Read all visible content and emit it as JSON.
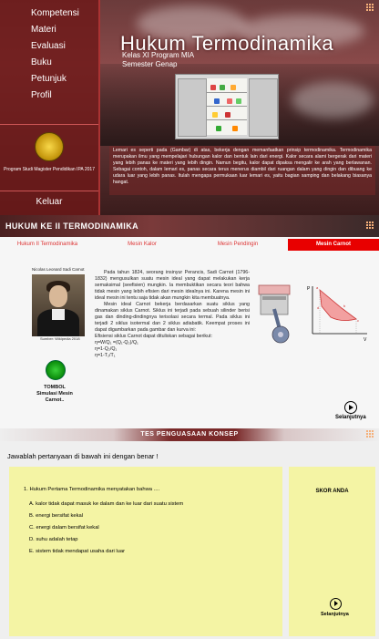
{
  "home": {
    "menu": [
      {
        "label": "Kompetensi"
      },
      {
        "label": "Materi"
      },
      {
        "label": "Evaluasi"
      },
      {
        "label": "Buku"
      },
      {
        "label": "Petunjuk"
      },
      {
        "label": "Profil"
      }
    ],
    "org_text": "Program Studi Magister Pendidikan IPA 2017",
    "exit_label": "Keluar",
    "title": "Hukum Termodinamika",
    "subtitle_class": "Kelas XI Program MIA",
    "subtitle_semester": "Semester Genap",
    "description": "Lemari es seperti pada (Gambar) di atas, bekerja dengan memanfaatkan prinsip termodinamika. Termodinamika merupakan ilmu yang mempelajari hubungan kalor dan bentuk lain dari energi. Kalor secara alami bergerak dari materi yang lebih panas ke materi yang lebih dingin. Namun begitu, kalor dapat dipaksa mengalir ke arah yang berlawanan. Sebagai contoh, dalam lemari es, panas secara terus menerus diambil dari ruangan dalam yang dingin dan dibuang ke udara luar yang lebih panas. Itulah mengapa permukaan luar lemari es, yaitu bagian samping dan belakang biasanya hangat."
  },
  "materi": {
    "header": "HUKUM KE II TERMODINAMIKA",
    "tabs": [
      {
        "label": "Hukum II Termodinamika",
        "active": false
      },
      {
        "label": "Mesin Kalor",
        "active": false
      },
      {
        "label": "Mesin Pendingin",
        "active": false
      },
      {
        "label": "Mesin Carnot",
        "active": true
      }
    ],
    "portrait_caption": "Nicolas Leonard Sadi Carnot",
    "portrait_source": "Sumber: Wikipedia 2018",
    "paragraphs": [
      "Pada tahun 1824, seorang insinyur Perancis, Sadi Carnot (1796-1832) mengusulkan suatu mesin ideal yang dapat melakukan kerja semaksimal (seefisien) mungkin. Ia membuktikan secara teori bahwa tidak mesin yang lebih efisien dari mesin idealnya ini. Karena mesin ini ideal mesin ini tentu saja tidak akan mungkin kita membuatnya.",
      "Mesin ideal Carnot bekerja berdasarkan suatu siklus yang dinamakan siklus Carnot. Siklus ini terjadi pada sebuah silinder berisi gas dan dinding-dindingnya terisolasi secara termal. Pada siklus ini terjadi 2 siklus isotermal dan 2 siklus adiabatik. Keempat proses ini dapat digambarkan pada gambar dan kurva ini:"
    ],
    "formula_intro": "Efisiensi siklus Carnot dapat dituliskan sebagai berikut:",
    "formulas": [
      "η=W/Q₁ =(Q₁-Q₂)/Q₁",
      "η=1-Q₂/Q₁",
      "η=1-T₂/T₁"
    ],
    "sim_button_line1": "TOMBOL",
    "sim_button_line2": "Simulasi Mesin Carnot..",
    "next_label": "Selanjutnya",
    "chart_labels": {
      "p": "P",
      "v": "V",
      "a": "a",
      "b": "b",
      "c": "c",
      "d": "d"
    }
  },
  "quiz": {
    "header": "TES PENGUASAAN KONSEP",
    "instruction": "Jawablah pertanyaan di bawah ini dengan benar !",
    "question": "1. Hukum Pertama Termodinamika menyatakan bahwa ....",
    "options": [
      {
        "letter": "A.",
        "text": "kalor tidak dapat masuk ke dalam dan ke luar dari suatu sistem"
      },
      {
        "letter": "B.",
        "text": "energi bersifat kekal"
      },
      {
        "letter": "C.",
        "text": "energi dalam bersifat kekal"
      },
      {
        "letter": "D.",
        "text": "suhu adalah tetap"
      },
      {
        "letter": "E.",
        "text": "sistem tidak mendapat usaha dari luar"
      }
    ],
    "score_label": "SKOR ANDA",
    "next_label": "Selanjutnya"
  },
  "colors": {
    "accent": "#e80000",
    "quiz_box": "#f5f596",
    "sidebar": "#6e1919"
  },
  "icons": {
    "grid": "grid-menu-icon",
    "next": "play-circle-icon"
  }
}
